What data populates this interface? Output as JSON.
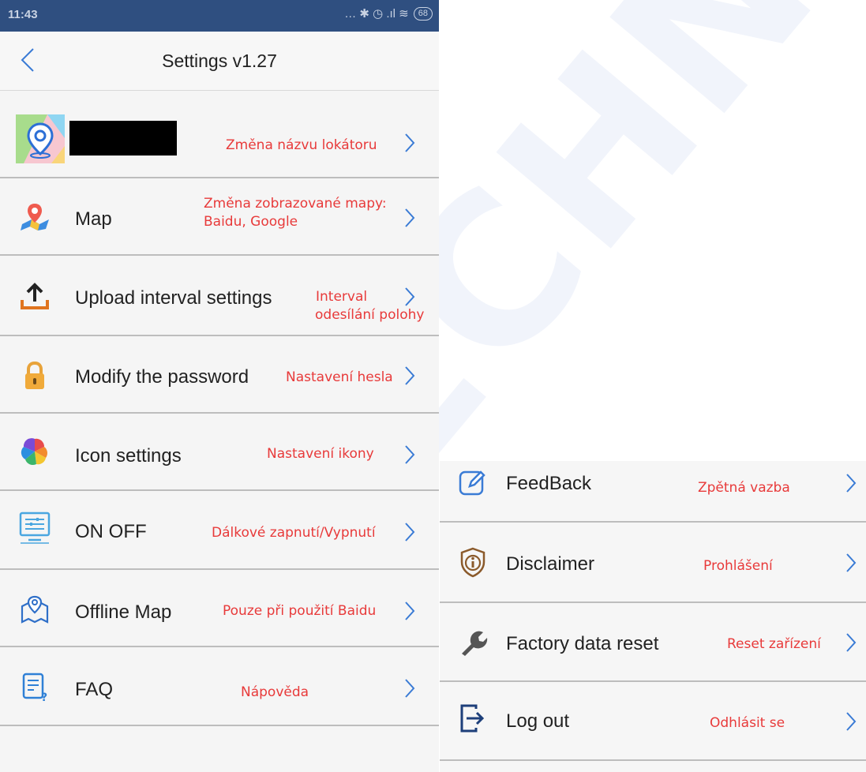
{
  "status_bar": {
    "time": "11:43",
    "icons": "… ✱ ◷ .ıl ≋",
    "battery": "68"
  },
  "header": {
    "title": "Settings v1.27"
  },
  "left_list": [
    {
      "label": "",
      "note": "Změna názvu lokátoru",
      "icon": "location-app-icon"
    },
    {
      "label": "Map",
      "note": "Změna zobrazované mapy:\nBaidu, Google",
      "icon": "map-pin-icon"
    },
    {
      "label": "Upload interval settings",
      "note": "Interval\nodesílání polohy",
      "icon": "upload-icon"
    },
    {
      "label": "Modify the password",
      "note": "Nastavení hesla",
      "icon": "lock-icon"
    },
    {
      "label": "Icon settings",
      "note": "Nastavení ikony",
      "icon": "color-wheel-icon"
    },
    {
      "label": "ON OFF",
      "note": "Dálkové zapnutí/Vypnutí",
      "icon": "sliders-monitor-icon"
    },
    {
      "label": "Offline Map",
      "note": "Pouze při použití Baidu",
      "icon": "offline-map-icon"
    },
    {
      "label": "FAQ",
      "note": "Nápověda",
      "icon": "faq-document-icon"
    }
  ],
  "right_list": [
    {
      "label": "FeedBack",
      "note": "Zpětná vazba",
      "icon": "edit-icon"
    },
    {
      "label": "Disclaimer",
      "note": "Prohlášení",
      "icon": "shield-info-icon"
    },
    {
      "label": "Factory data reset",
      "note": "Reset zařízení",
      "icon": "wrench-icon"
    },
    {
      "label": "Log out",
      "note": "Odhlásit se",
      "icon": "logout-icon"
    }
  ],
  "watermark": "ECHNIK.CZ",
  "colors": {
    "status_bar": "#2f4f80",
    "note_text": "#e83a3a",
    "accent_blue": "#3a7bd5"
  }
}
